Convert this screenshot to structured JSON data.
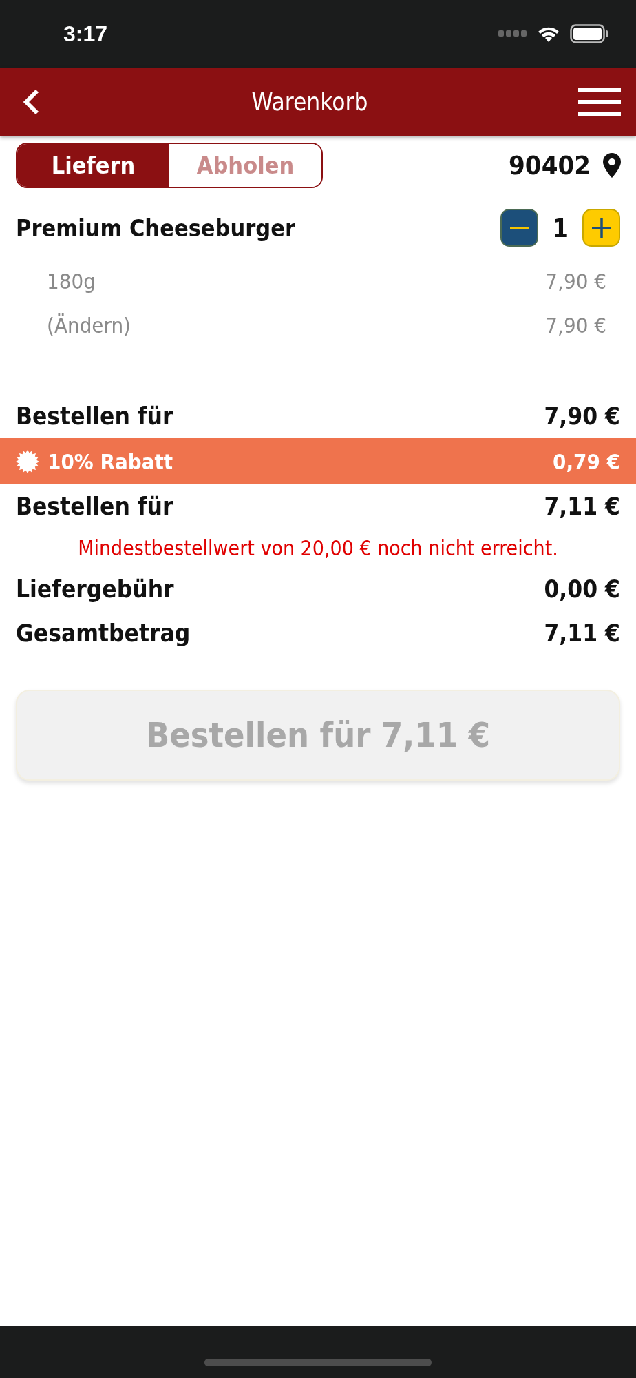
{
  "status_bar": {
    "time": "3:17"
  },
  "nav_bar": {
    "title": "Warenkorb"
  },
  "delivery_toggle": [
    {
      "label": "Liefern",
      "selected": true
    },
    {
      "label": "Abholen",
      "selected": false
    }
  ],
  "zip_code": "90402",
  "cart_items": [
    {
      "name": "Premium Cheeseburger",
      "quantity": "1",
      "options": [
        {
          "label": "180g",
          "price": "7,90 €"
        },
        {
          "label": "(Ändern)",
          "price": "7,90 €"
        }
      ]
    }
  ],
  "summary": [
    {
      "kind": "line",
      "label": "Bestellen für",
      "amount": "7,90 €"
    },
    {
      "kind": "discount",
      "label": "10% Rabatt",
      "amount": "0,79 €"
    },
    {
      "kind": "line",
      "label": "Bestellen für",
      "amount": "7,11 €"
    },
    {
      "kind": "warning",
      "text": "Mindestbestellwert von 20,00 € noch nicht erreicht."
    },
    {
      "kind": "line",
      "label": "Liefergebühr",
      "amount": "0,00 €"
    },
    {
      "kind": "line",
      "label": "Gesamtbetrag",
      "amount": "7,11 €"
    }
  ],
  "order_button": {
    "label": "Bestellen für 7,11 €",
    "disabled": true
  }
}
